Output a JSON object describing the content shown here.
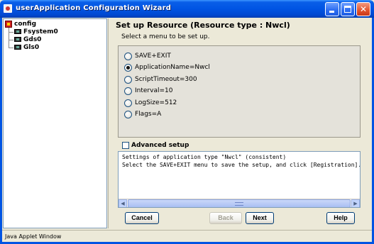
{
  "window": {
    "title": "userApplication Configuration Wizard"
  },
  "tree": {
    "root": "config",
    "children": [
      "Fsystem0",
      "Gds0",
      "Gls0"
    ]
  },
  "main": {
    "heading": "Set up Resource (Resource type : Nwcl)",
    "subheading": "Select a menu to be set up.",
    "menu_items": [
      {
        "label": "SAVE+EXIT",
        "selected": false
      },
      {
        "label": "ApplicationName=Nwcl",
        "selected": true
      },
      {
        "label": "ScriptTimeout=300",
        "selected": false
      },
      {
        "label": "Interval=10",
        "selected": false
      },
      {
        "label": "LogSize=512",
        "selected": false
      },
      {
        "label": "Flags=A",
        "selected": false
      }
    ],
    "advanced_setup_label": "Advanced setup",
    "advanced_setup_checked": false,
    "messages": [
      "Settings of application type \"Nwcl\" (consistent)",
      "Select the SAVE+EXIT menu to save the setup, and click [Registration]."
    ]
  },
  "buttons": {
    "cancel": "Cancel",
    "back": "Back",
    "next": "Next",
    "help": "Help"
  },
  "status": {
    "text": "Java Applet Window"
  }
}
